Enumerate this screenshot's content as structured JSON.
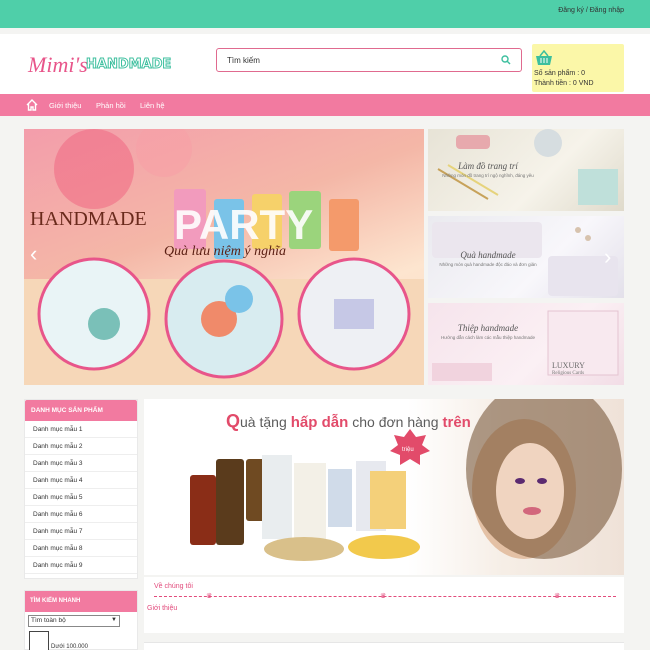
{
  "top": {
    "register": "Đăng ký",
    "separator": "/",
    "login": "Đăng nhập",
    "bar_color": "#4fcfa9"
  },
  "logo": {
    "script": "Mimi's",
    "word": "HANDMADE",
    "pink": "#e8558a",
    "teal": "#3cbf9e"
  },
  "search": {
    "value": "Tìm kiếm",
    "icon": "search-icon"
  },
  "cart": {
    "icon": "basket-icon",
    "count_label": "Số sản phẩm :",
    "count_value": "0",
    "total_label": "Thành tiền :",
    "total_value": "0 VND",
    "background": "#fbf7a8"
  },
  "nav": {
    "home_icon": "home-icon",
    "items": [
      "Giới thiệu",
      "Phản hồi",
      "Liên hệ"
    ],
    "color": "#f27aa0"
  },
  "slider": {
    "main_title": "HANDMADE",
    "main_word": "PARTY",
    "main_subtitle": "Quà lưu niệm ý nghĩa",
    "prev_icon": "chevron-left-icon",
    "next_icon": "chevron-right-icon",
    "side": [
      {
        "title": "Làm đồ trang trí",
        "subtitle": "Những món đồ trang trí ngộ nghĩnh, đáng yêu"
      },
      {
        "title": "Quà handmade",
        "subtitle": "Những món quà handmade độc đáo và đơn giản"
      },
      {
        "title": "Thiệp handmade",
        "subtitle": "Hướng dẫn cách làm các mẫu thiệp handmade",
        "badge": "LUXURY",
        "badge_sub": "Religious Cards"
      }
    ]
  },
  "categories": {
    "heading": "DANH MỤC SẢN PHẨM",
    "items": [
      "Danh mục mẫu 1",
      "Danh mục mẫu 2",
      "Danh mục mẫu 3",
      "Danh mục mẫu 4",
      "Danh mục mẫu 5",
      "Danh mục mẫu 6",
      "Danh mục mẫu 7",
      "Danh mục mẫu 8",
      "Danh mục mẫu 9"
    ]
  },
  "quick_search": {
    "heading": "TÌM KIẾM NHANH",
    "select_value": "Tìm toàn bộ",
    "price_label": "Dưới",
    "price_value": "100.000"
  },
  "banner": {
    "text_a": "Q",
    "text_b": "uà tặng",
    "text_c": "hấp dẫn",
    "text_d": "cho đơn hàng",
    "text_e": "trên",
    "badge": "triệu"
  },
  "about": {
    "title": "Về chúng tôi",
    "link": "Giới thiệu"
  }
}
